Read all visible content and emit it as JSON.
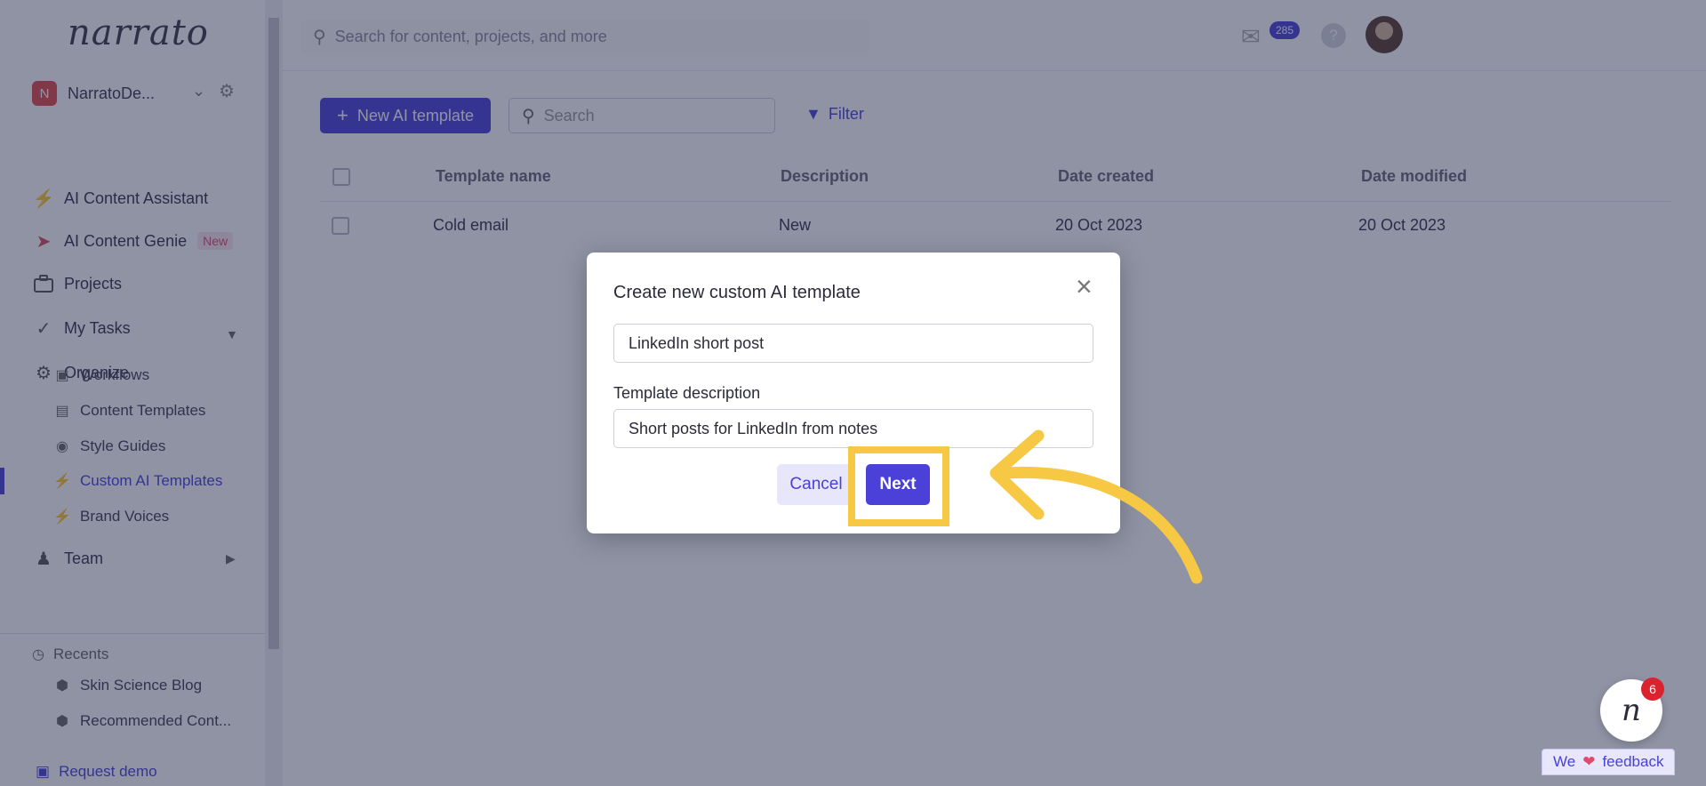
{
  "app": {
    "logo": "narrato"
  },
  "workspace": {
    "initial": "N",
    "name": "NarratoDe..."
  },
  "sidebar": {
    "items": [
      {
        "label": "AI Content Assistant"
      },
      {
        "label": "AI Content Genie",
        "badge": "New"
      },
      {
        "label": "Projects"
      },
      {
        "label": "My Tasks"
      },
      {
        "label": "Organize"
      },
      {
        "label": "Team"
      }
    ],
    "organize_sub": [
      {
        "label": "Workflows"
      },
      {
        "label": "Content Templates"
      },
      {
        "label": "Style Guides"
      },
      {
        "label": "Custom AI Templates",
        "active": true
      },
      {
        "label": "Brand Voices"
      }
    ],
    "recents_label": "Recents",
    "recents": [
      {
        "label": "Skin Science Blog"
      },
      {
        "label": "Recommended Cont..."
      }
    ],
    "request_demo": "Request demo"
  },
  "topbar": {
    "search_placeholder": "Search for content, projects, and more",
    "mail_count": "285",
    "help_label": "?"
  },
  "toolbar": {
    "new_template_label": "New AI template",
    "search_placeholder": "Search",
    "filter_label": "Filter"
  },
  "table": {
    "headers": [
      "Template name",
      "Description",
      "Date created",
      "Date modified"
    ],
    "rows": [
      {
        "name": "Cold email",
        "description": "New",
        "created": "20 Oct 2023",
        "modified": "20 Oct 2023"
      }
    ]
  },
  "modal": {
    "title": "Create new custom AI template",
    "name_value": "LinkedIn short post",
    "description_label": "Template description",
    "description_value": "Short posts for LinkedIn from notes",
    "cancel_label": "Cancel",
    "next_label": "Next"
  },
  "chat": {
    "count": "6",
    "glyph": "n"
  },
  "feedback": {
    "prefix": "We",
    "suffix": "feedback"
  },
  "colors": {
    "accent": "#4b40d8",
    "highlight": "#f7c843",
    "overlay": "rgba(32,40,74,0.5)"
  }
}
